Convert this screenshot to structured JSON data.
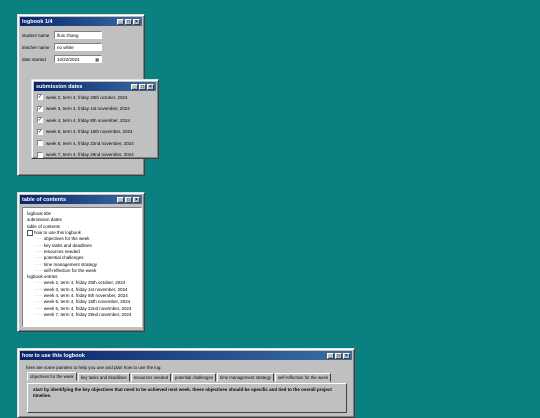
{
  "logbook_window": {
    "title": "logbook 1/4",
    "student_name_label": "student name",
    "student_name_value": "lfuis zhang",
    "teacher_name_label": "teacher name",
    "teacher_name_value": "no white",
    "date_started_label": "date started",
    "date_started_value": "10/22/2024"
  },
  "submission_window": {
    "title": "submission dates",
    "items": [
      {
        "label": "week 2, term 4, friday 25th october, 2024",
        "checked": true
      },
      {
        "label": "week 3, term 4, friday 1st november, 2024",
        "checked": true
      },
      {
        "label": "week 4, term 4, friday 8th november, 2024",
        "checked": true
      },
      {
        "label": "week 5, term 4, friday 15th november, 2024",
        "checked": true
      },
      {
        "label": "week 6, term 4, friday 22nd november, 2024",
        "checked": false
      },
      {
        "label": "week 7, term 4, friday 29nd november, 2024",
        "checked": false
      }
    ]
  },
  "toc_window": {
    "title": "table of contents",
    "items": [
      {
        "label": "logbook title",
        "level": 0
      },
      {
        "label": "submission dates",
        "level": 0
      },
      {
        "label": "table of contents",
        "level": 0
      },
      {
        "label": "how to use this logbook",
        "level": 0,
        "box": true
      },
      {
        "label": "objectives for the week",
        "level": 1
      },
      {
        "label": "key tasks and deadlines",
        "level": 1
      },
      {
        "label": "resources needed",
        "level": 1
      },
      {
        "label": "potential challenges",
        "level": 1
      },
      {
        "label": "time management strategy",
        "level": 1
      },
      {
        "label": "self-reflection for the week",
        "level": 1
      },
      {
        "label": "logbook entries",
        "level": 0
      },
      {
        "label": "week 2, term 4, friday 25th october, 2024",
        "level": 1
      },
      {
        "label": "week 3, term 4, friday 1st november, 2024",
        "level": 1
      },
      {
        "label": "week 4, term 4, friday 8th november, 2024",
        "level": 1
      },
      {
        "label": "week 5, term 4, friday 15th november, 2024",
        "level": 1
      },
      {
        "label": "week 6, term 4, friday 22nd november, 2024",
        "level": 1
      },
      {
        "label": "week 7, term 4, friday 29nd november, 2024",
        "level": 1
      }
    ]
  },
  "howto_window": {
    "title": "how to use this logbook",
    "intro": "here are some pointers to help you use and plan how to use the log:",
    "tabs": [
      "objectives for the week",
      "key tasks and deadlines",
      "resources needed",
      "potential challenges",
      "time management strategy",
      "self-reflection for the week"
    ],
    "active_tab": 0,
    "panel_text": "start by identifying the key objectives that need to be achieved next week. these objectives should be specific and tied to the overall project timeline."
  },
  "titlebar_buttons": {
    "minimize": "_",
    "maximize": "□",
    "close": "×"
  }
}
